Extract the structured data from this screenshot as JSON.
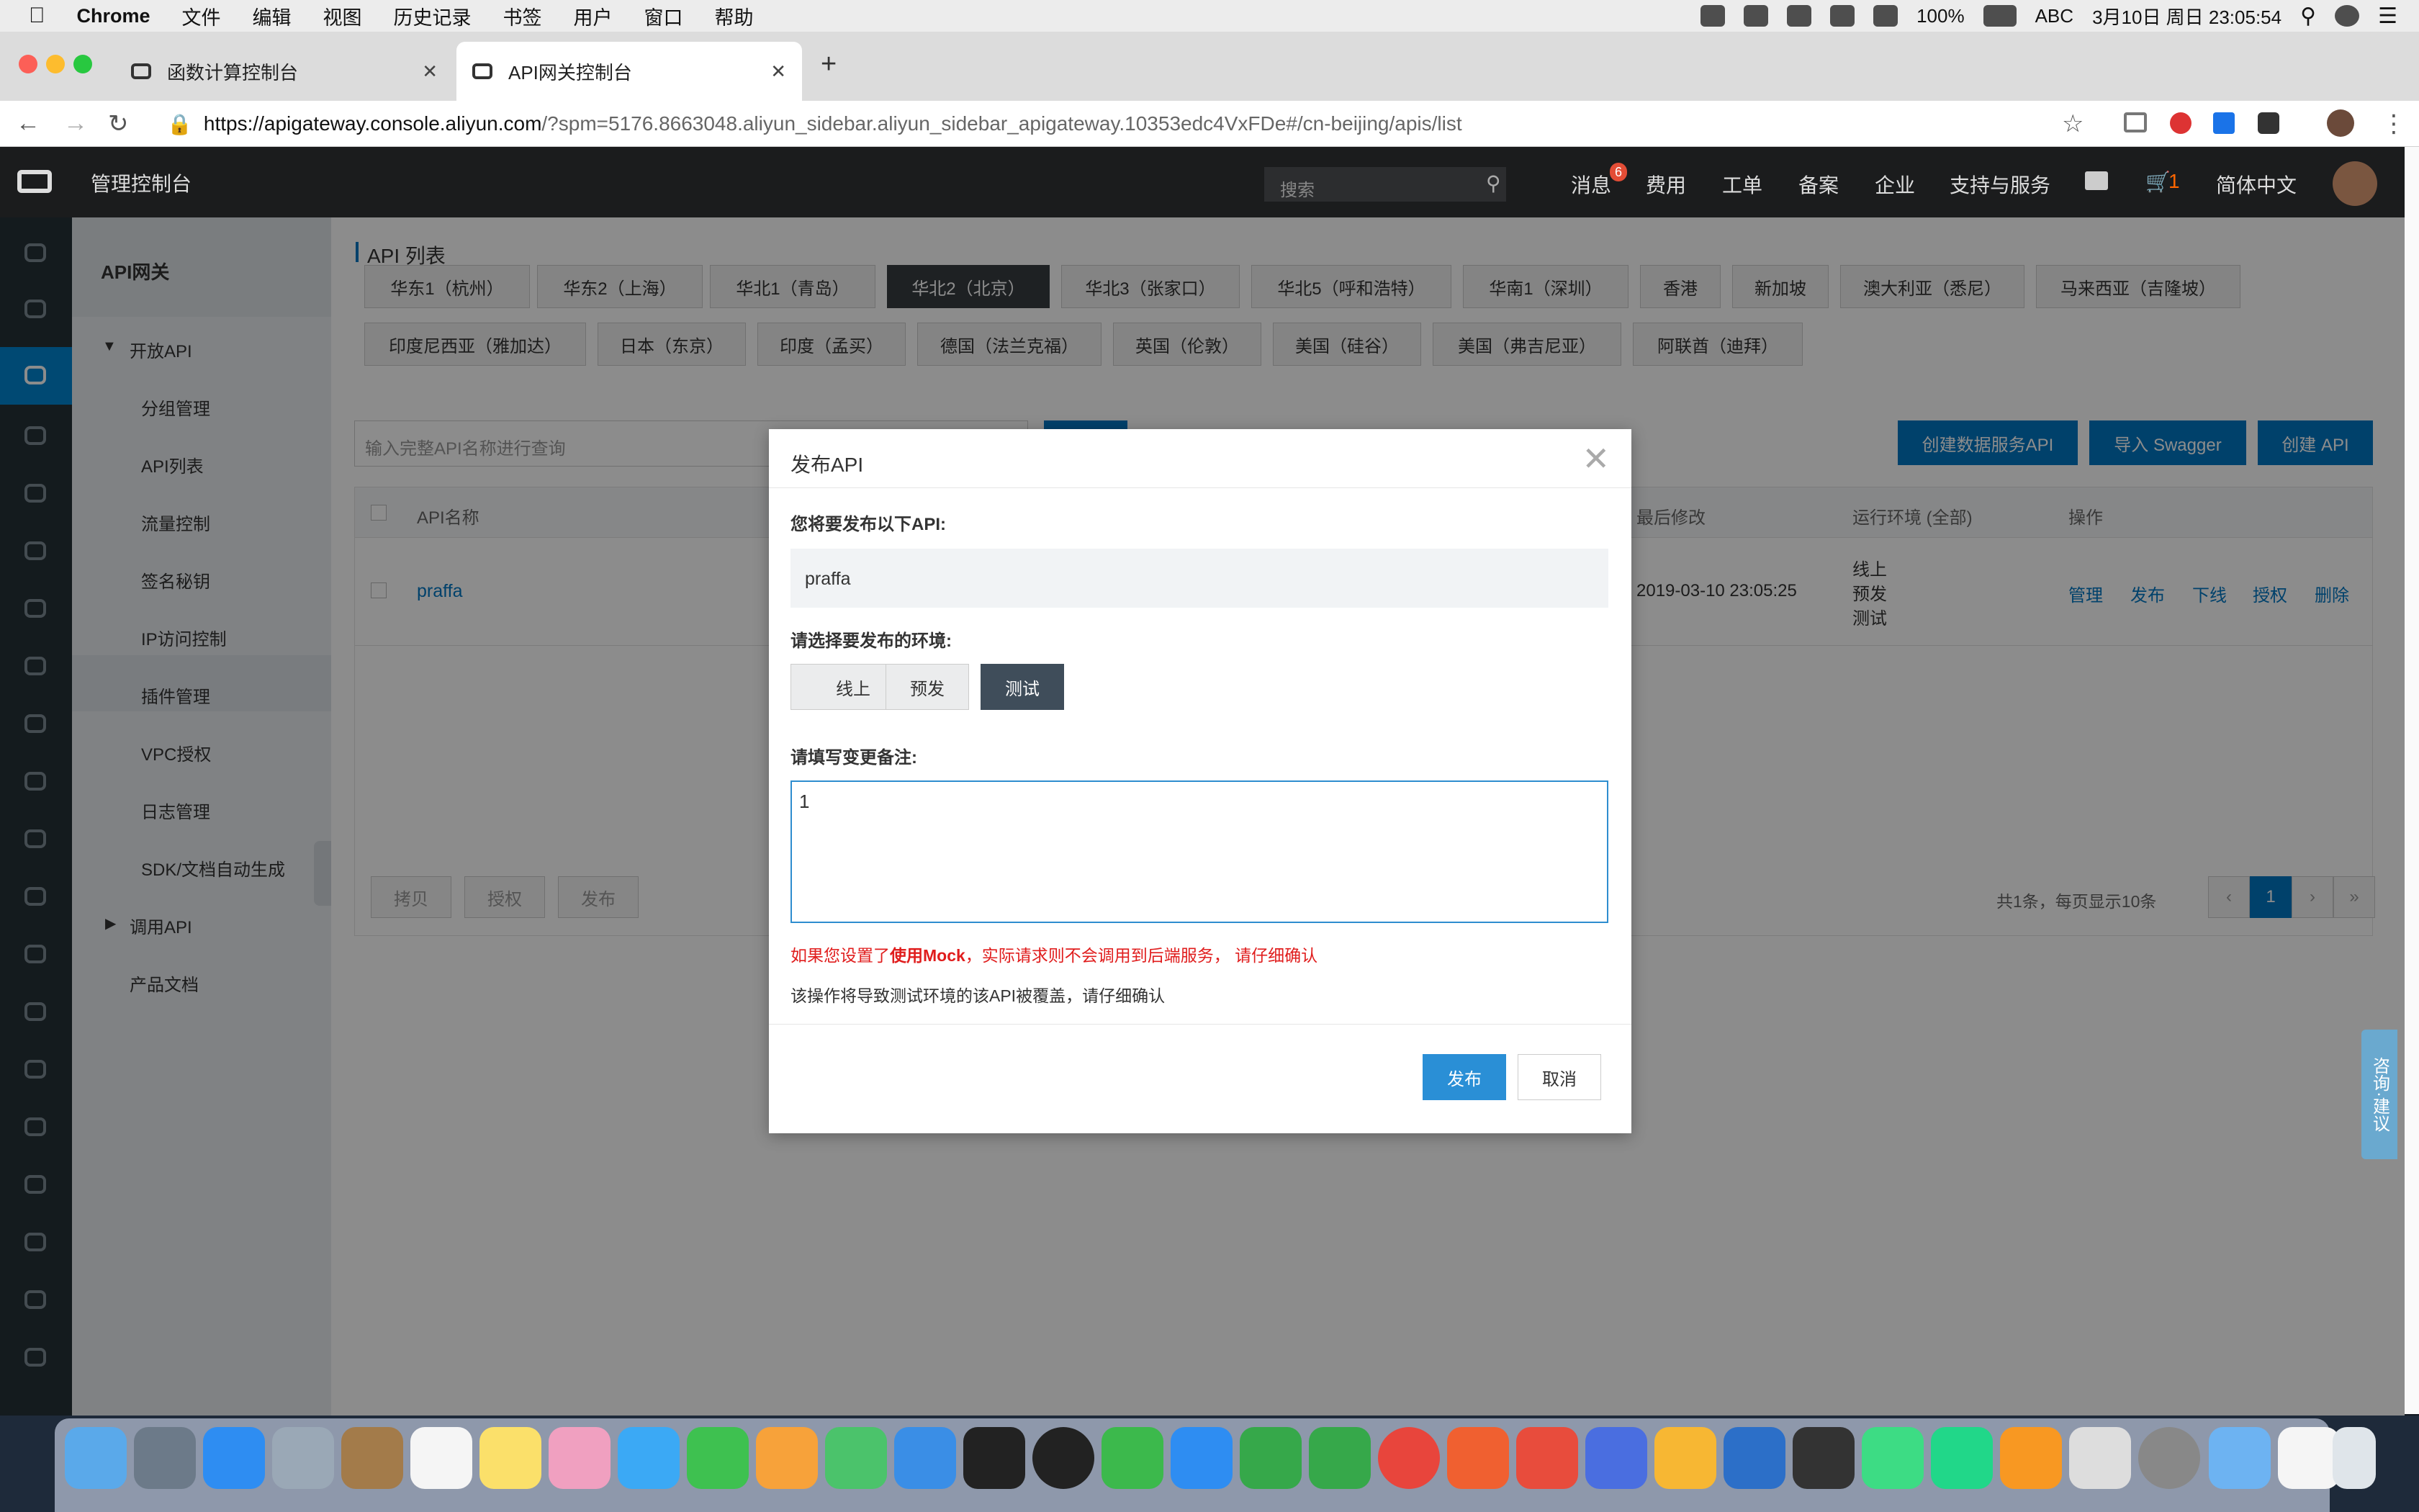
{
  "menubar": {
    "app": "Chrome",
    "menus": [
      "文件",
      "编辑",
      "视图",
      "历史记录",
      "书签",
      "用户",
      "窗口",
      "帮助"
    ],
    "battery": "100%",
    "input": "ABC",
    "datetime": "3月10日 周日  23:05:54"
  },
  "tabs": [
    {
      "label": "函数计算控制台"
    },
    {
      "label": "API网关控制台"
    }
  ],
  "address": {
    "host": "https://apigateway.console.aliyun.com",
    "path": "/?spm=5176.8663048.aliyun_sidebar.aliyun_sidebar_apigateway.10353edc4VxFDe#/cn-beijing/apis/list"
  },
  "header": {
    "brand": "管理控制台",
    "search_placeholder": "搜索",
    "messages": "消息",
    "message_count": "6",
    "items": [
      "费用",
      "工单",
      "备案",
      "企业",
      "支持与服务"
    ],
    "cart_count": "1",
    "language": "简体中文"
  },
  "nav": {
    "title": "API网关",
    "open_api": "开放API",
    "items": [
      "分组管理",
      "API列表",
      "流量控制",
      "签名秘钥",
      "IP访问控制",
      "插件管理",
      "VPC授权",
      "日志管理",
      "SDK/文档自动生成"
    ],
    "call_api": "调用API",
    "docs": "产品文档"
  },
  "main": {
    "title": "API 列表",
    "regions_row1": [
      "华东1（杭州）",
      "华东2（上海）",
      "华北1（青岛）",
      "华北2（北京）",
      "华北3（张家口）",
      "华北5（呼和浩特）",
      "华南1（深圳）",
      "香港",
      "新加坡",
      "澳大利亚（悉尼）",
      "马来西亚（吉隆坡）"
    ],
    "regions_row2": [
      "印度尼西亚（雅加达）",
      "日本（东京）",
      "印度（孟买）",
      "德国（法兰克福）",
      "英国（伦敦）",
      "美国（硅谷）",
      "美国（弗吉尼亚）",
      "阿联酋（迪拜）"
    ],
    "active_region": "华北2（北京）",
    "search_placeholder": "输入完整API名称进行查询",
    "create_data_api": "创建数据服务API",
    "import_swagger": "导入 Swagger",
    "create_api": "创建 API",
    "columns": {
      "name": "API名称",
      "modified": "最后修改",
      "env": "运行环境 (全部)",
      "ops": "操作"
    },
    "row": {
      "name": "praffa",
      "modified": "2019-03-10 23:05:25",
      "envs": [
        "线上",
        "预发",
        "测试"
      ],
      "ops": [
        "管理",
        "发布",
        "下线",
        "授权",
        "删除"
      ]
    },
    "bulk": [
      "拷贝",
      "授权",
      "发布"
    ],
    "pagination_info": "共1条，每页显示10条",
    "pages": [
      "‹",
      "1",
      "›",
      "»"
    ]
  },
  "modal": {
    "title": "发布API",
    "label_api": "您将要发布以下API:",
    "api_name": "praffa",
    "label_env": "请选择要发布的环境:",
    "envs": [
      "线上",
      "预发",
      "测试"
    ],
    "selected_env": "测试",
    "label_remark": "请填写变更备注:",
    "remark_value": "1",
    "warning_pre": "如果您设置了",
    "warning_mock": "使用Mock",
    "warning_post": "，实际请求则不会调用到后端服务，  请仔细确认",
    "note": "该操作将导致测试环境的该API被覆盖，请仔细确认",
    "publish": "发布",
    "cancel": "取消"
  },
  "feedback": "咨询·建议"
}
